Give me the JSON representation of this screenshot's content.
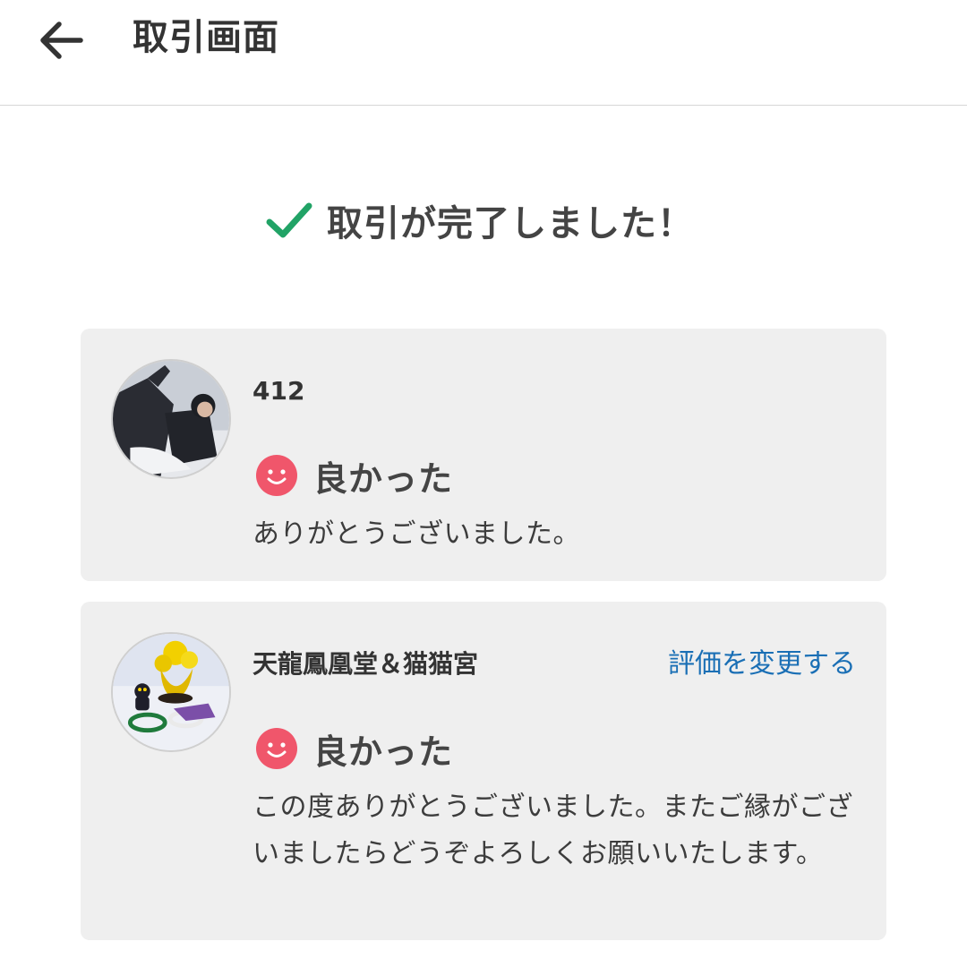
{
  "header": {
    "title": "取引画面",
    "back_icon": "arrow-left-icon"
  },
  "status": {
    "message": "取引が完了しました！",
    "icon": "check-icon",
    "icon_color": "#21a366"
  },
  "reviews": [
    {
      "user": "412",
      "rating_icon": "smile-icon",
      "rating": "良かった",
      "comment": "ありがとうございました。"
    },
    {
      "user": "天龍鳳凰堂＆猫猫宮",
      "action": "評価を変更する",
      "rating_icon": "smile-icon",
      "rating": "良かった",
      "comment": "この度ありがとうございました。またご縁がございましたらどうぞよろしくお願いいたします。"
    }
  ],
  "colors": {
    "link": "#1a6fb5",
    "smile": "#f0566b",
    "card_bg": "#efefef"
  }
}
